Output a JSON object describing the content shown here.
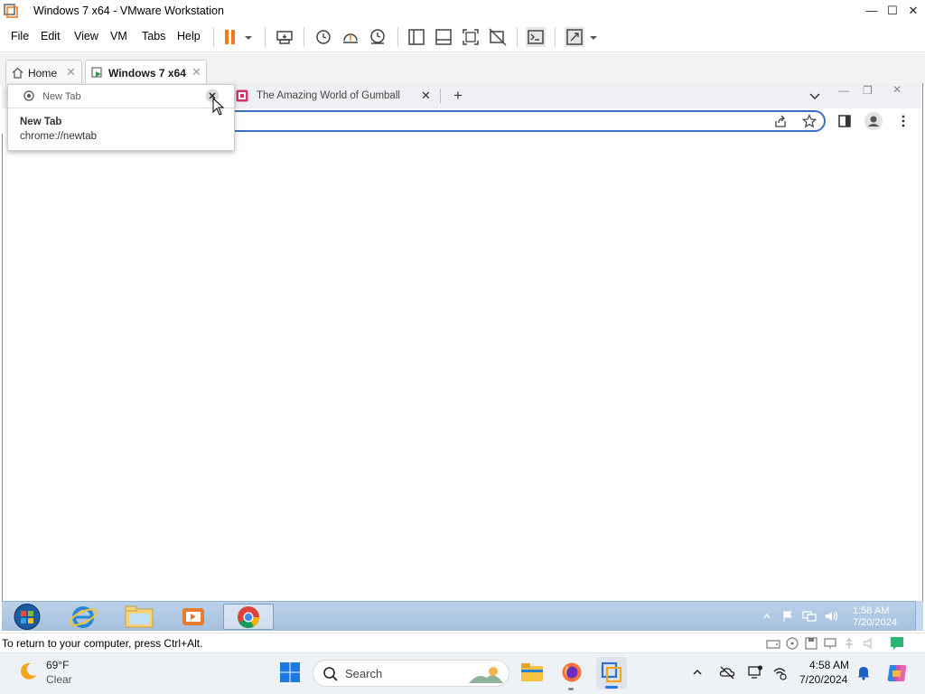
{
  "window": {
    "title": "Windows 7 x64 - VMware Workstation",
    "controls": {
      "minimize": "—",
      "maximize": "☐",
      "close": "✕"
    }
  },
  "menubar": {
    "items": [
      "File",
      "Edit",
      "View",
      "VM",
      "Tabs",
      "Help"
    ]
  },
  "vm_tabs": [
    {
      "label": "Home",
      "icon": "home-icon",
      "active": false
    },
    {
      "label": "Windows 7 x64",
      "icon": "vm-icon",
      "active": true
    }
  ],
  "chrome": {
    "tabs": [
      {
        "label": "New Tab",
        "favicon": "chrome-icon"
      },
      {
        "label": "The Amazing World of Gumball",
        "favicon": "site-icon"
      }
    ],
    "new_tab_button": "+",
    "hover_card": {
      "tab_title": "New Tab",
      "title": "New Tab",
      "url": "chrome://newtab"
    },
    "window_controls": {
      "minimize": "—",
      "restore": "❐",
      "close": "✕"
    }
  },
  "win7_taskbar": {
    "time": "1:58 AM",
    "date": "7/20/2024",
    "pinned": [
      "start-orb",
      "internet-explorer",
      "windows-explorer",
      "media-player",
      "google-chrome"
    ]
  },
  "statusbar": {
    "message": "To return to your computer, press Ctrl+Alt."
  },
  "host_taskbar": {
    "weather": {
      "temp": "69°F",
      "condition": "Clear"
    },
    "search_placeholder": "Search",
    "time": "4:58 AM",
    "date": "7/20/2024"
  },
  "colors": {
    "vmware_pause": "#f07c1e",
    "omnibox_border": "#3b6fc6",
    "win7_taskbar": "#b9d0e8",
    "host_taskbar": "#eef1f6"
  }
}
